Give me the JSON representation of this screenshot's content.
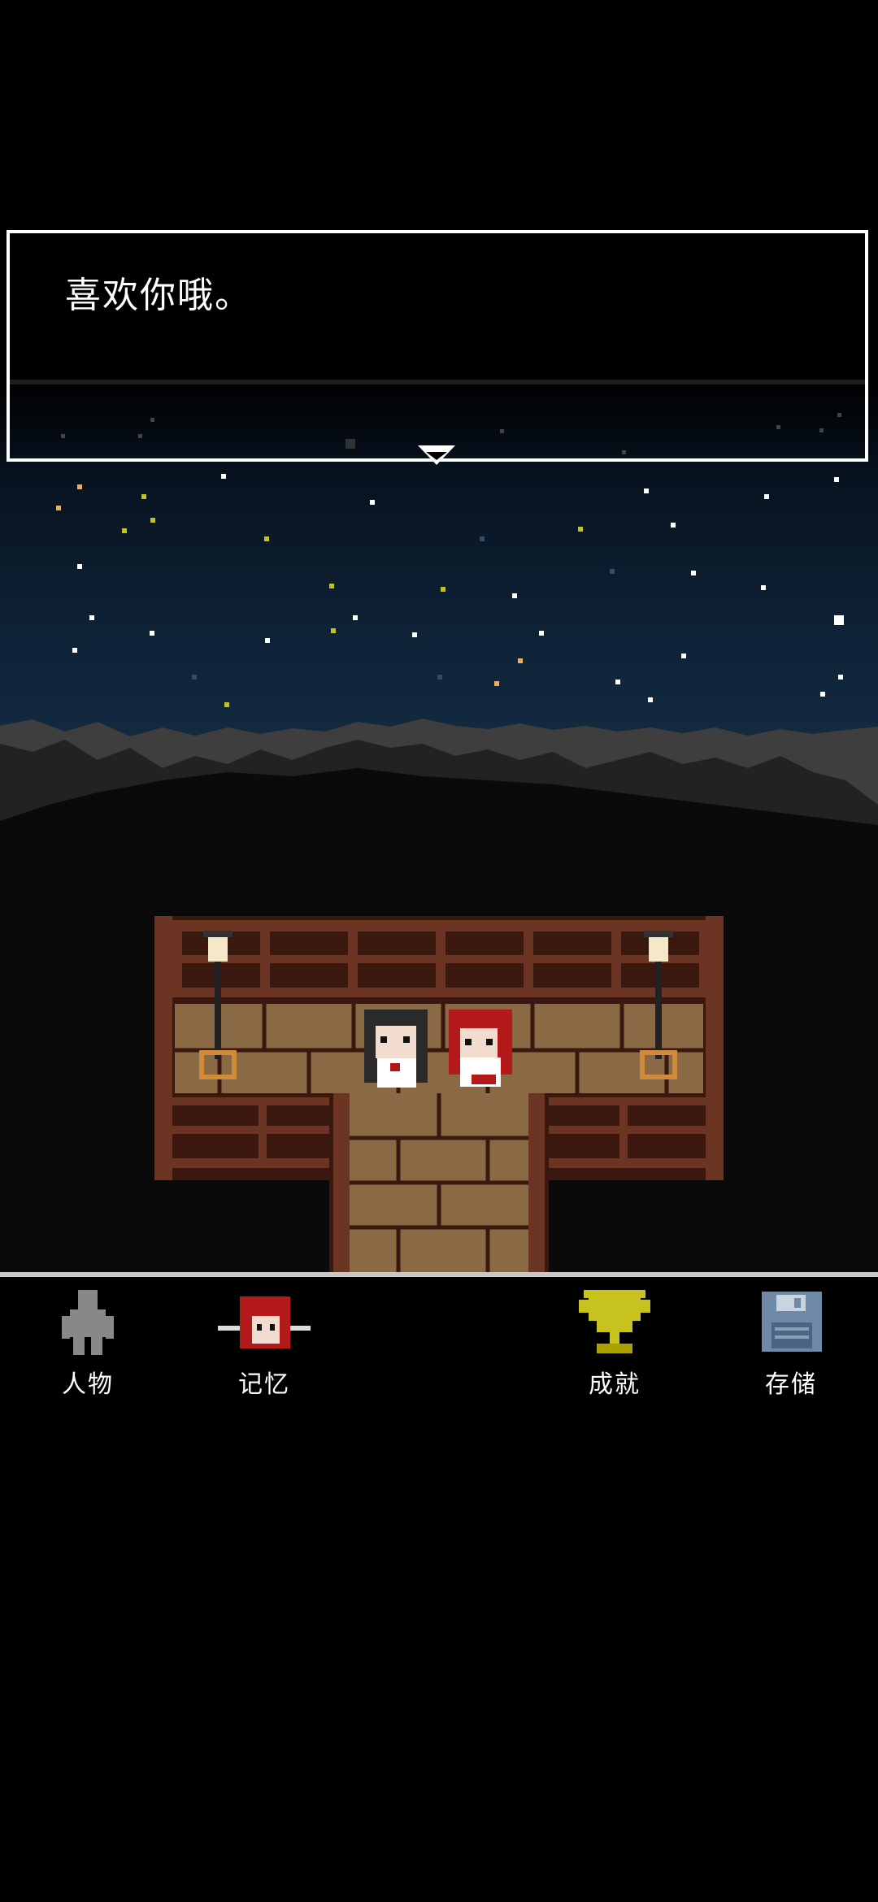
{
  "dialog": {
    "text": "喜欢你哦。"
  },
  "menu": {
    "characters": {
      "label": "人物",
      "icon": "character-silhouette-icon"
    },
    "memories": {
      "label": "记忆",
      "icon": "red-hair-girl-icon"
    },
    "achievements": {
      "label": "成就",
      "icon": "trophy-icon"
    },
    "save": {
      "label": "存储",
      "icon": "floppy-disk-icon"
    }
  },
  "colors": {
    "sky": "#0b1c2d",
    "wood": "#5b2e1f",
    "brick": "#8a6a44",
    "trophy": "#c8c21e",
    "floppy": "#6e8aa8"
  }
}
